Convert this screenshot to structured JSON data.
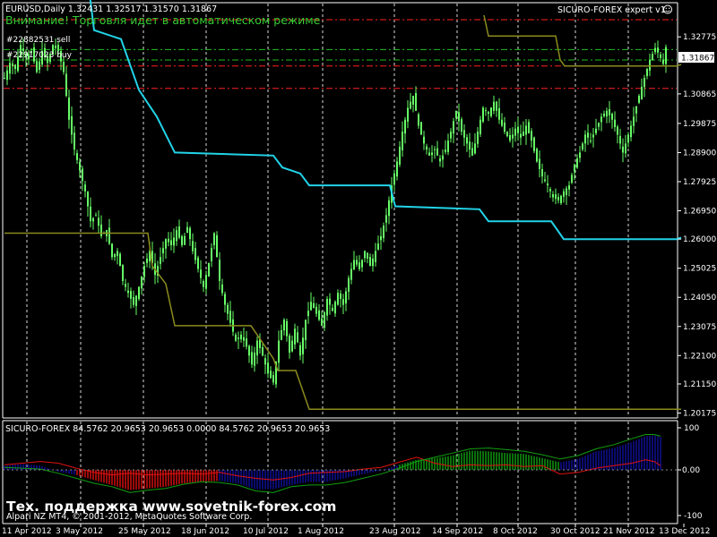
{
  "header": {
    "symbol_info": "EURUSD,Daily  1.32431 1.32517 1.31570 1.31867",
    "expert_name": "SICURO-FOREX expert v1",
    "warning": "Внимание! Торговля идет в автоматическом режиме",
    "order_sell": "#22882531 sell",
    "order_buy": "#22917023 buy"
  },
  "price_axis": {
    "labels": [
      "1.32775",
      "1.31867",
      "1.30865",
      "1.29875",
      "1.28900",
      "1.27925",
      "1.26950",
      "1.26000",
      "1.25025",
      "1.24050",
      "1.23075",
      "1.22100",
      "1.21150",
      "1.20175"
    ],
    "current": "1.31867"
  },
  "indicator": {
    "header": "SICURO-FOREX 84.5762 20.9653 20.9653 0.0000 84.5762 20.9653 20.9653",
    "levels": [
      "100",
      "0.00",
      "-100"
    ]
  },
  "date_axis": [
    "11 Apr 2012",
    "3 May 2012",
    "25 May 2012",
    "18 Jun 2012",
    "10 Jul 2012",
    "1 Aug 2012",
    "23 Aug 2012",
    "14 Sep 2012",
    "8 Oct 2012",
    "30 Oct 2012",
    "21 Nov 2012",
    "13 Dec 2012"
  ],
  "footer": {
    "support": "Тех. поддержка www.sovetnik-forex.com",
    "copyright": "Alpari NZ MT4, © 2001-2012, MetaQuotes Software Corp."
  },
  "colors": {
    "candles": "#66ff66",
    "cyan_line": "#22d3e8",
    "olive_line": "#8b8b1e",
    "red_lines": "#ff2020",
    "green_lines": "#20c020",
    "warning_text": "#33cc33",
    "blue_hist": "#1010a0",
    "red_hist": "#e01010",
    "green_hist": "#10a010"
  },
  "chart_data": {
    "type": "candlestick",
    "symbol": "EURUSD",
    "timeframe": "Daily",
    "last_bar": {
      "open": 1.32431,
      "high": 1.32517,
      "low": 1.3157,
      "close": 1.31867
    },
    "ylim": [
      1.201,
      1.3305
    ],
    "price_path": [
      [
        0,
        1.314
      ],
      [
        6,
        1.319
      ],
      [
        12,
        1.317
      ],
      [
        18,
        1.325
      ],
      [
        24,
        1.321
      ],
      [
        30,
        1.323
      ],
      [
        36,
        1.316
      ],
      [
        42,
        1.323
      ],
      [
        48,
        1.319
      ],
      [
        54,
        1.325
      ],
      [
        60,
        1.323
      ],
      [
        66,
        1.316
      ],
      [
        72,
        1.3
      ],
      [
        78,
        1.29
      ],
      [
        84,
        1.283
      ],
      [
        90,
        1.276
      ],
      [
        96,
        1.266
      ],
      [
        102,
        1.268
      ],
      [
        108,
        1.261
      ],
      [
        114,
        1.263
      ],
      [
        120,
        1.254
      ],
      [
        126,
        1.256
      ],
      [
        132,
        1.246
      ],
      [
        138,
        1.242
      ],
      [
        144,
        1.238
      ],
      [
        150,
        1.244
      ],
      [
        156,
        1.251
      ],
      [
        162,
        1.256
      ],
      [
        168,
        1.248
      ],
      [
        174,
        1.254
      ],
      [
        180,
        1.26
      ],
      [
        186,
        1.258
      ],
      [
        192,
        1.263
      ],
      [
        198,
        1.258
      ],
      [
        204,
        1.264
      ],
      [
        210,
        1.256
      ],
      [
        216,
        1.25
      ],
      [
        222,
        1.244
      ],
      [
        228,
        1.252
      ],
      [
        234,
        1.262
      ],
      [
        240,
        1.246
      ],
      [
        246,
        1.238
      ],
      [
        252,
        1.232
      ],
      [
        258,
        1.226
      ],
      [
        264,
        1.228
      ],
      [
        270,
        1.224
      ],
      [
        276,
        1.218
      ],
      [
        282,
        1.226
      ],
      [
        288,
        1.221
      ],
      [
        294,
        1.215
      ],
      [
        300,
        1.212
      ],
      [
        306,
        1.226
      ],
      [
        312,
        1.233
      ],
      [
        318,
        1.222
      ],
      [
        324,
        1.23
      ],
      [
        330,
        1.221
      ],
      [
        336,
        1.233
      ],
      [
        342,
        1.239
      ],
      [
        348,
        1.235
      ],
      [
        354,
        1.231
      ],
      [
        360,
        1.24
      ],
      [
        366,
        1.236
      ],
      [
        372,
        1.242
      ],
      [
        378,
        1.238
      ],
      [
        384,
        1.247
      ],
      [
        390,
        1.253
      ],
      [
        396,
        1.25
      ],
      [
        402,
        1.256
      ],
      [
        408,
        1.251
      ],
      [
        414,
        1.256
      ],
      [
        420,
        1.261
      ],
      [
        426,
        1.268
      ],
      [
        432,
        1.278
      ],
      [
        438,
        1.286
      ],
      [
        444,
        1.296
      ],
      [
        450,
        1.304
      ],
      [
        456,
        1.308
      ],
      [
        462,
        1.298
      ],
      [
        468,
        1.292
      ],
      [
        474,
        1.288
      ],
      [
        480,
        1.29
      ],
      [
        486,
        1.286
      ],
      [
        492,
        1.29
      ],
      [
        498,
        1.296
      ],
      [
        504,
        1.303
      ],
      [
        510,
        1.296
      ],
      [
        516,
        1.292
      ],
      [
        522,
        1.288
      ],
      [
        528,
        1.296
      ],
      [
        534,
        1.304
      ],
      [
        540,
        1.302
      ],
      [
        546,
        1.306
      ],
      [
        552,
        1.3
      ],
      [
        558,
        1.296
      ],
      [
        564,
        1.293
      ],
      [
        570,
        1.297
      ],
      [
        576,
        1.294
      ],
      [
        582,
        1.298
      ],
      [
        588,
        1.293
      ],
      [
        594,
        1.286
      ],
      [
        600,
        1.281
      ],
      [
        606,
        1.278
      ],
      [
        612,
        1.274
      ],
      [
        618,
        1.273
      ],
      [
        624,
        1.276
      ],
      [
        630,
        1.278
      ],
      [
        636,
        1.285
      ],
      [
        642,
        1.289
      ],
      [
        648,
        1.295
      ],
      [
        654,
        1.293
      ],
      [
        660,
        1.297
      ],
      [
        666,
        1.301
      ],
      [
        672,
        1.303
      ],
      [
        678,
        1.3
      ],
      [
        684,
        1.295
      ],
      [
        690,
        1.289
      ],
      [
        696,
        1.295
      ],
      [
        702,
        1.301
      ],
      [
        708,
        1.308
      ],
      [
        714,
        1.314
      ],
      [
        720,
        1.32
      ],
      [
        726,
        1.324
      ],
      [
        730,
        1.322
      ],
      [
        735,
        1.3187
      ]
    ],
    "cyan_line": [
      [
        0,
        1.342
      ],
      [
        95,
        1.342
      ],
      [
        100,
        1.33
      ],
      [
        130,
        1.327
      ],
      [
        150,
        1.31
      ],
      [
        170,
        1.301
      ],
      [
        190,
        1.289
      ],
      [
        300,
        1.288
      ],
      [
        310,
        1.284
      ],
      [
        330,
        1.282
      ],
      [
        340,
        1.278
      ],
      [
        430,
        1.278
      ],
      [
        436,
        1.271
      ],
      [
        530,
        1.27
      ],
      [
        540,
        1.266
      ],
      [
        610,
        1.266
      ],
      [
        624,
        1.26
      ],
      [
        750,
        1.26
      ],
      [
        755,
        1.2605
      ]
    ],
    "olive_line": [
      [
        0,
        1.262
      ],
      [
        160,
        1.262
      ],
      [
        165,
        1.251
      ],
      [
        180,
        1.245
      ],
      [
        190,
        1.231
      ],
      [
        275,
        1.231
      ],
      [
        300,
        1.22
      ],
      [
        305,
        1.216
      ],
      [
        325,
        1.216
      ],
      [
        340,
        1.203
      ],
      [
        755,
        1.203
      ]
    ],
    "olive_line_top": [
      [
        535,
        1.335
      ],
      [
        540,
        1.328
      ],
      [
        615,
        1.328
      ],
      [
        620,
        1.32
      ],
      [
        625,
        1.318
      ],
      [
        750,
        1.318
      ],
      [
        755,
        1.3185
      ]
    ],
    "horizontal_levels": {
      "red_dashed": [
        1.3335,
        1.318,
        1.3105
      ],
      "green_dashdot": [
        1.3235,
        1.32
      ]
    },
    "indicator": {
      "name": "SICURO-FOREX",
      "levels": [
        100,
        0,
        -100
      ],
      "ylim": [
        -105,
        105
      ],
      "upper_line": [
        [
          0,
          12
        ],
        [
          20,
          16
        ],
        [
          40,
          20
        ],
        [
          60,
          16
        ],
        [
          80,
          4
        ],
        [
          100,
          -6
        ],
        [
          120,
          -12
        ],
        [
          140,
          -8
        ],
        [
          160,
          -12
        ],
        [
          180,
          -10
        ],
        [
          200,
          -8
        ],
        [
          220,
          -10
        ],
        [
          240,
          -6
        ],
        [
          260,
          -14
        ],
        [
          280,
          -20
        ],
        [
          300,
          -24
        ],
        [
          320,
          -18
        ],
        [
          340,
          -8
        ],
        [
          360,
          -6
        ],
        [
          380,
          -4
        ],
        [
          400,
          2
        ],
        [
          420,
          6
        ],
        [
          440,
          18
        ],
        [
          460,
          30
        ],
        [
          480,
          16
        ],
        [
          500,
          8
        ],
        [
          520,
          12
        ],
        [
          540,
          10
        ],
        [
          560,
          12
        ],
        [
          580,
          8
        ],
        [
          600,
          10
        ],
        [
          620,
          -10
        ],
        [
          640,
          -6
        ],
        [
          660,
          4
        ],
        [
          680,
          10
        ],
        [
          700,
          16
        ],
        [
          715,
          24
        ],
        [
          725,
          20
        ],
        [
          732,
          10
        ]
      ],
      "lower_line": [
        [
          0,
          6
        ],
        [
          20,
          4
        ],
        [
          40,
          2
        ],
        [
          60,
          -8
        ],
        [
          80,
          -20
        ],
        [
          100,
          -32
        ],
        [
          120,
          -40
        ],
        [
          140,
          -54
        ],
        [
          160,
          -48
        ],
        [
          180,
          -44
        ],
        [
          200,
          -34
        ],
        [
          220,
          -28
        ],
        [
          240,
          -30
        ],
        [
          260,
          -36
        ],
        [
          280,
          -50
        ],
        [
          300,
          -54
        ],
        [
          320,
          -40
        ],
        [
          340,
          -36
        ],
        [
          360,
          -36
        ],
        [
          380,
          -30
        ],
        [
          400,
          -20
        ],
        [
          420,
          -10
        ],
        [
          440,
          4
        ],
        [
          460,
          20
        ],
        [
          480,
          30
        ],
        [
          500,
          40
        ],
        [
          520,
          50
        ],
        [
          540,
          52
        ],
        [
          560,
          48
        ],
        [
          580,
          44
        ],
        [
          600,
          36
        ],
        [
          620,
          26
        ],
        [
          640,
          34
        ],
        [
          660,
          50
        ],
        [
          680,
          60
        ],
        [
          700,
          74
        ],
        [
          715,
          84
        ],
        [
          725,
          84
        ],
        [
          732,
          80
        ]
      ],
      "histogram": [
        [
          0,
          10
        ],
        [
          20,
          14
        ],
        [
          40,
          10
        ],
        [
          60,
          -4
        ],
        [
          80,
          -12
        ],
        [
          100,
          -24
        ],
        [
          120,
          -36
        ],
        [
          140,
          -48
        ],
        [
          160,
          -44
        ],
        [
          180,
          -40
        ],
        [
          200,
          -32
        ],
        [
          220,
          -28
        ],
        [
          240,
          -26
        ],
        [
          260,
          -32
        ],
        [
          280,
          -46
        ],
        [
          300,
          -46
        ],
        [
          320,
          -36
        ],
        [
          340,
          -28
        ],
        [
          360,
          -28
        ],
        [
          380,
          -20
        ],
        [
          400,
          -10
        ],
        [
          420,
          -2
        ],
        [
          440,
          12
        ],
        [
          460,
          24
        ],
        [
          480,
          28
        ],
        [
          500,
          34
        ],
        [
          520,
          46
        ],
        [
          540,
          44
        ],
        [
          560,
          40
        ],
        [
          580,
          38
        ],
        [
          600,
          28
        ],
        [
          620,
          18
        ],
        [
          640,
          26
        ],
        [
          660,
          44
        ],
        [
          680,
          52
        ],
        [
          700,
          66
        ],
        [
          715,
          80
        ],
        [
          725,
          82
        ],
        [
          732,
          78
        ]
      ]
    }
  }
}
